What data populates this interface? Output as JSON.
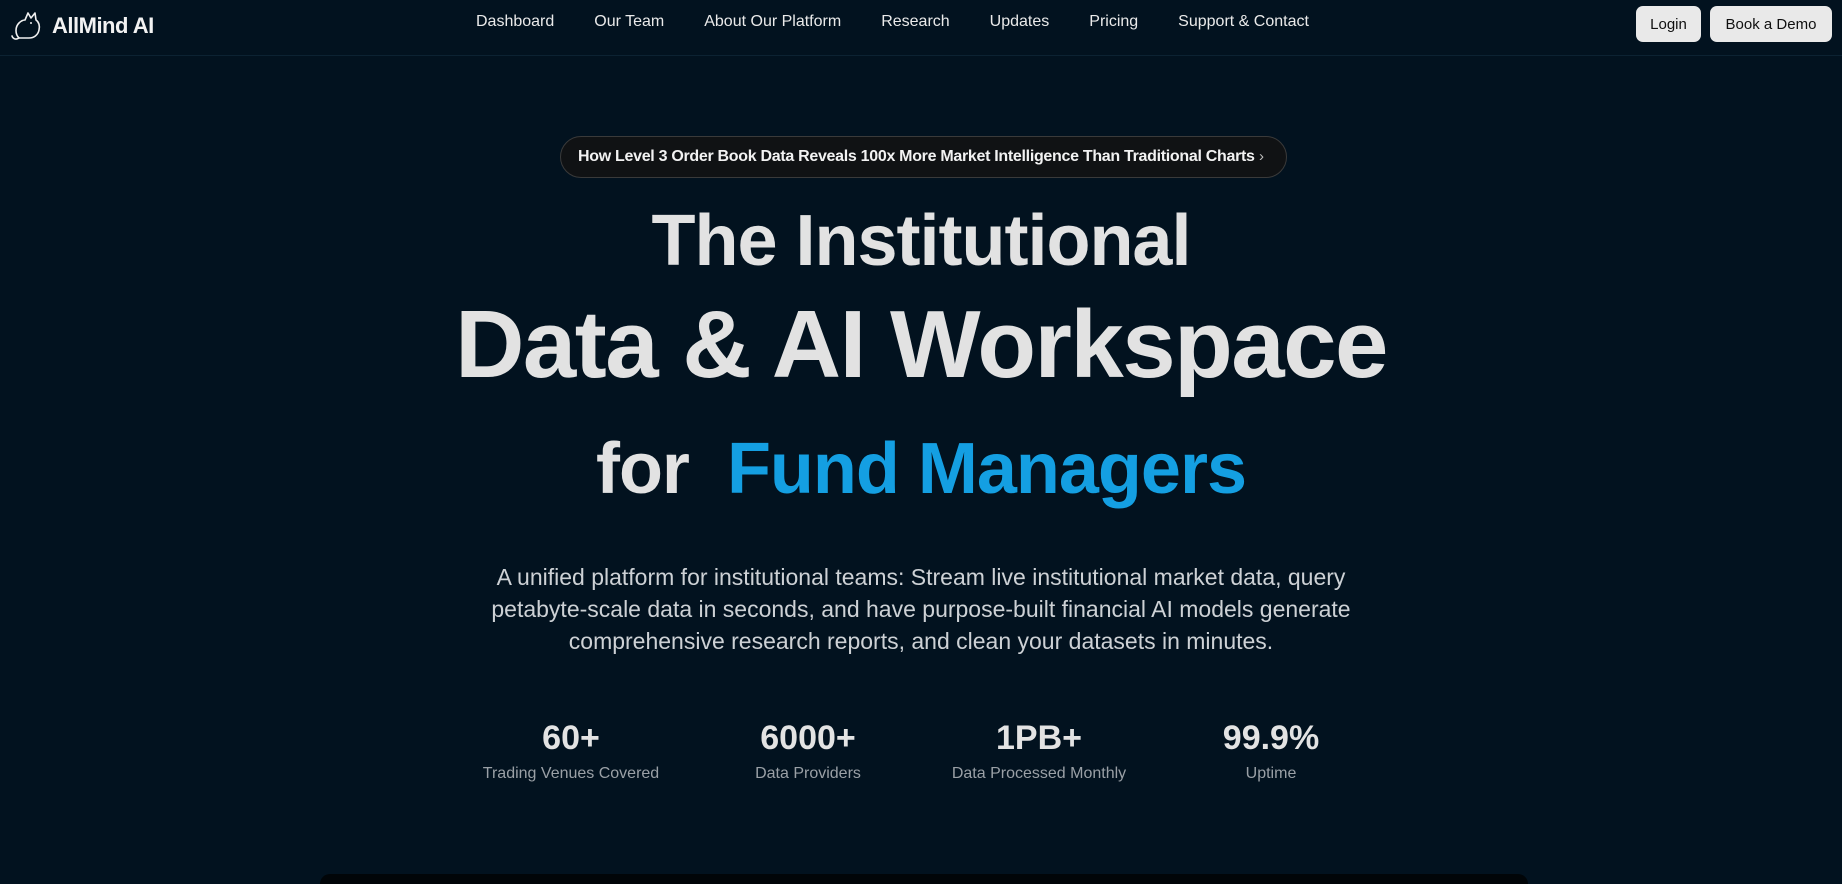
{
  "brand": {
    "name": "AllMind AI",
    "icon": "cat-logo-icon"
  },
  "nav": {
    "items": [
      "Dashboard",
      "Our Team",
      "About Our Platform",
      "Research",
      "Updates",
      "Pricing",
      "Support & Contact"
    ]
  },
  "header_actions": {
    "login_label": "Login",
    "demo_label": "Book a Demo"
  },
  "announcement": {
    "text": "How Level 3 Order Book Data Reveals 100x More Market Intelligence Than Traditional Charts",
    "chevron": "›"
  },
  "hero": {
    "line1": "The Institutional",
    "line2": "Data & AI Workspace",
    "line3_prefix": "for",
    "line3_accent": "Fund Managers",
    "accent_color": "#149fe2",
    "description": "A unified platform for institutional teams: Stream live institutional market data, query petabyte-scale data in seconds, and have purpose-built financial AI models generate comprehensive research reports, and clean your datasets in minutes."
  },
  "stats": [
    {
      "value": "60+",
      "label": "Trading Venues Covered"
    },
    {
      "value": "6000+",
      "label": "Data Providers"
    },
    {
      "value": "1PB+",
      "label": "Data Processed Monthly"
    },
    {
      "value": "99.9%",
      "label": "Uptime"
    }
  ],
  "colors": {
    "background": "#02121f",
    "text": "#e2e2e2",
    "button_bg": "#e9e9e9"
  }
}
